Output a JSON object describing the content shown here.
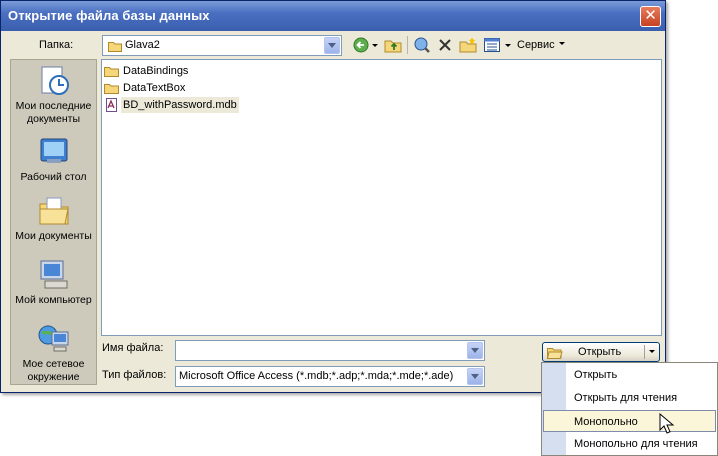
{
  "window": {
    "title": "Открытие файла базы данных",
    "close_glyph": "✕"
  },
  "lookin": {
    "label": "Папка:",
    "value": "Glava2"
  },
  "toolbar": {
    "tools_label": "Сервис",
    "icons": [
      "back-icon",
      "dropdown-arrow-icon",
      "up-folder-icon",
      "search-web-icon",
      "delete-icon",
      "new-folder-icon",
      "views-icon",
      "tools-dropdown-icon"
    ]
  },
  "places": [
    {
      "label": "Мои последние документы",
      "icon": "recent-documents-icon"
    },
    {
      "label": "Рабочий стол",
      "icon": "desktop-icon"
    },
    {
      "label": "Мои документы",
      "icon": "my-documents-icon"
    },
    {
      "label": "Мой компьютер",
      "icon": "my-computer-icon"
    },
    {
      "label": "Мое сетевое окружение",
      "icon": "network-places-icon"
    }
  ],
  "files": [
    {
      "name": "DataBindings",
      "type": "folder"
    },
    {
      "name": "DataTextBox",
      "type": "folder"
    },
    {
      "name": "BD_withPassword.mdb",
      "type": "mdb"
    }
  ],
  "filename": {
    "label": "Имя файла:",
    "value": ""
  },
  "filetype": {
    "label": "Тип файлов:",
    "value": "Microsoft Office Access (*.mdb;*.adp;*.mda;*.mde;*.ade)"
  },
  "open_button": {
    "label": "Открыть"
  },
  "open_menu": {
    "items": [
      {
        "label": "Открыть",
        "highlighted": false
      },
      {
        "label": "Открыть для чтения",
        "highlighted": false
      },
      {
        "label": "Монопольно",
        "highlighted": true
      },
      {
        "label": "Монопольно для чтения",
        "highlighted": false
      }
    ]
  },
  "colors": {
    "titlebar": "#3b5fae",
    "dialog_bg": "#ece9d8",
    "sidebar_bg": "#cdc9bb",
    "menu_highlight": "#fbf6d9"
  }
}
